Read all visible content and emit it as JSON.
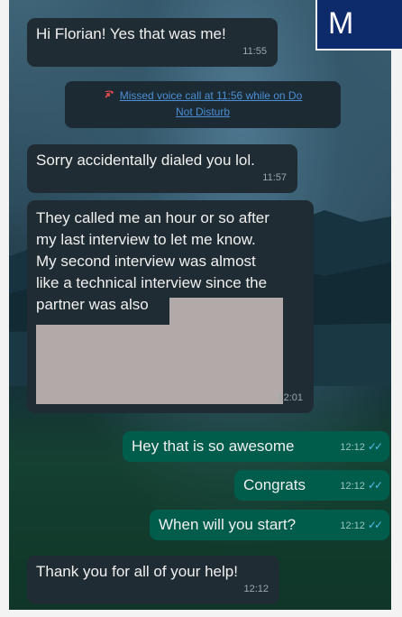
{
  "header": {
    "partial_title": "M"
  },
  "messages": [
    {
      "direction": "incoming",
      "text": "Hi Florian! Yes that was me!",
      "time": "11:55"
    },
    {
      "direction": "incoming",
      "text": "Sorry accidentally dialed you lol.",
      "time": "11:57"
    },
    {
      "direction": "incoming",
      "lines": [
        "They called me an hour or so after",
        "my last interview to let me know.",
        "My second interview was almost",
        "like a technical interview since the",
        "partner was also"
      ],
      "time": "12:01",
      "redacted": true
    },
    {
      "direction": "outgoing",
      "text": "Hey that is so awesome",
      "time": "12:12",
      "status": "read"
    },
    {
      "direction": "outgoing",
      "text": "Congrats",
      "time": "12:12",
      "status": "read"
    },
    {
      "direction": "outgoing",
      "text": "When will you start?",
      "time": "12:12",
      "status": "read"
    },
    {
      "direction": "incoming",
      "text": "Thank you for all of your help!",
      "time": "12:12"
    }
  ],
  "system_event": {
    "icon": "missed-call-icon",
    "text": "Missed voice call at 11:56 while on Do Not Disturb",
    "line1": "Missed voice call at 11:56 while on Do",
    "line2": "Not Disturb"
  },
  "colors": {
    "incoming_bubble": "#202c33",
    "outgoing_bubble": "#005c4b",
    "read_ticks": "#53bdeb",
    "missed_call_red": "#e5484d",
    "link_blue": "#4b8fd6"
  }
}
